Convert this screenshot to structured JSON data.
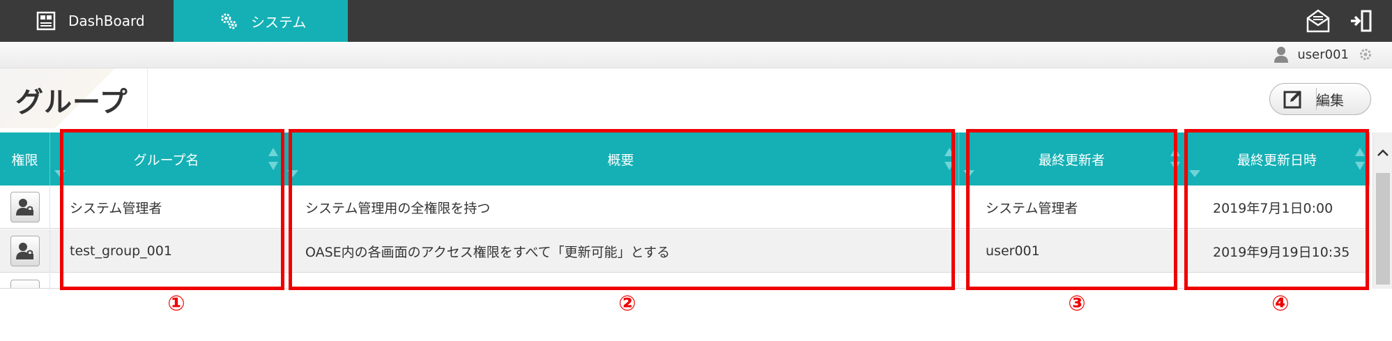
{
  "nav": {
    "tabs": [
      {
        "label": "DashBoard",
        "icon": "dashboard-icon"
      },
      {
        "label": "システム",
        "icon": "gears-icon",
        "active": true
      }
    ],
    "right_icons": [
      "mail-icon",
      "logout-icon"
    ]
  },
  "user": {
    "name": "user001",
    "icon": "user-icon",
    "settings_icon": "gear-icon"
  },
  "page": {
    "title": "グループ"
  },
  "edit_button": {
    "label": "編集",
    "icon": "edit-icon"
  },
  "table": {
    "headers": [
      "権限",
      "グループ名",
      "概要",
      "最終更新者",
      "最終更新日時"
    ],
    "rows": [
      {
        "name": "システム管理者",
        "summary": "システム管理用の全権限を持つ",
        "updated_by": "システム管理者",
        "updated_at": "2019年7月1日0:00"
      },
      {
        "name": "test_group_001",
        "summary": "OASE内の各画面のアクセス権限をすべて「更新可能」とする",
        "updated_by": "user001",
        "updated_at": "2019年9月19日10:35"
      }
    ]
  },
  "annotations": [
    "①",
    "②",
    "③",
    "④"
  ],
  "colors": {
    "accent": "#14b0b5",
    "topbar": "#3a3a3a",
    "annotation": "#ee0000"
  }
}
